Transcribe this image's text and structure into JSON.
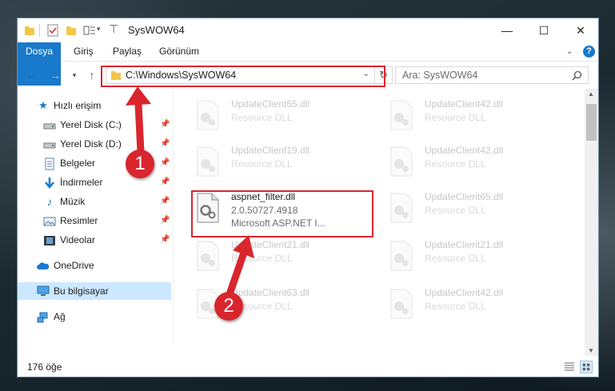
{
  "window": {
    "title": "SysWOW64"
  },
  "ribbon": {
    "tabs": [
      "Dosya",
      "Giriş",
      "Paylaş",
      "Görünüm"
    ]
  },
  "address": {
    "path": "C:\\Windows\\SysWOW64"
  },
  "search": {
    "placeholder": "Ara: SysWOW64"
  },
  "sidebar": {
    "quick_access": "Hızlı erişim",
    "items": [
      {
        "label": "Yerel Disk (C:)",
        "icon": "drive-icon"
      },
      {
        "label": "Yerel Disk (D:)",
        "icon": "drive-icon"
      },
      {
        "label": "Belgeler",
        "icon": "documents-icon"
      },
      {
        "label": "İndirmeler",
        "icon": "downloads-icon"
      },
      {
        "label": "Müzik",
        "icon": "music-icon"
      },
      {
        "label": "Resimler",
        "icon": "pictures-icon"
      },
      {
        "label": "Videolar",
        "icon": "videos-icon"
      }
    ],
    "onedrive": "OneDrive",
    "this_pc": "Bu bilgisayar",
    "network": "Ağ"
  },
  "files": [
    {
      "name": "UpdateClient65.dll",
      "type": "Resource DLL"
    },
    {
      "name": "UpdateClient42.dll",
      "type": "Resource DLL"
    },
    {
      "name": "UpdateClient19.dll",
      "type": "Resource DLL"
    },
    {
      "name": "UpdateClient42.dll",
      "type": "Resource DLL"
    },
    {
      "name": "aspnet_filter.dll",
      "version": "2.0.50727.4918",
      "company": "Microsoft ASP.NET I..."
    },
    {
      "name": "UpdateClient65.dll",
      "type": "Resource DLL"
    },
    {
      "name": "UpdateClient21.dll",
      "type": "Resource DLL"
    },
    {
      "name": "UpdateClient21.dll",
      "type": "Resource DLL"
    },
    {
      "name": "UpdateClient63.dll",
      "type": "Resource DLL"
    },
    {
      "name": "UpdateClient42.dll",
      "type": "Resource DLL"
    }
  ],
  "status": {
    "count": "176 öğe"
  },
  "annotations": {
    "step1": "1",
    "step2": "2"
  },
  "colors": {
    "accent": "#1979ca",
    "highlight": "#d9262e",
    "selected_nav": "#cce8ff"
  }
}
